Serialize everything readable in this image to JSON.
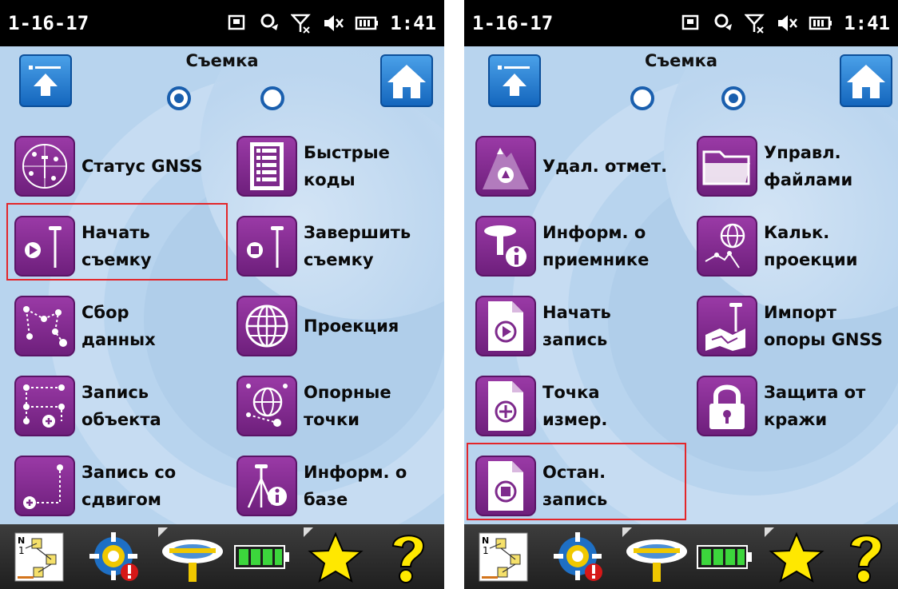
{
  "left_screen": {
    "status": {
      "date": "1-16-17",
      "time": "1:41"
    },
    "title": "Съемка",
    "items": [
      {
        "label": "Статус GNSS"
      },
      {
        "label": "Быстрые\nкоды"
      },
      {
        "label": "Начать\nсъемку"
      },
      {
        "label": "Завершить\nсъемку"
      },
      {
        "label": "Сбор\nданных"
      },
      {
        "label": "Проекция"
      },
      {
        "label": "Запись\nобъекта"
      },
      {
        "label": "Опорные\nточки"
      },
      {
        "label": "Запись со\nсдвигом"
      },
      {
        "label": "Информ. о\nбазе"
      }
    ]
  },
  "right_screen": {
    "status": {
      "date": "1-16-17",
      "time": "1:41"
    },
    "title": "Съемка",
    "items": [
      {
        "label": "Удал. отмет."
      },
      {
        "label": "Управл.\nфайлами"
      },
      {
        "label": "Информ. о\nприемнике"
      },
      {
        "label": "Кальк.\nпроекции"
      },
      {
        "label": "Начать\nзапись"
      },
      {
        "label": "Импорт\nопоры GNSS"
      },
      {
        "label": "Точка\nизмер."
      },
      {
        "label": "Защита от\nкражи"
      },
      {
        "label": "Остан.\nзапись"
      }
    ]
  },
  "toolbar": {
    "icons": [
      "map-view-icon",
      "settings-gear-icon",
      "gnss-receiver-icon",
      "battery-icon",
      "favorites-star-icon",
      "help-question-icon"
    ]
  },
  "colors": {
    "accent_purple": "#7e2a8c",
    "nav_blue": "#1a6fc7",
    "highlight_red": "#e3262a",
    "background": "#b8d4ee"
  }
}
